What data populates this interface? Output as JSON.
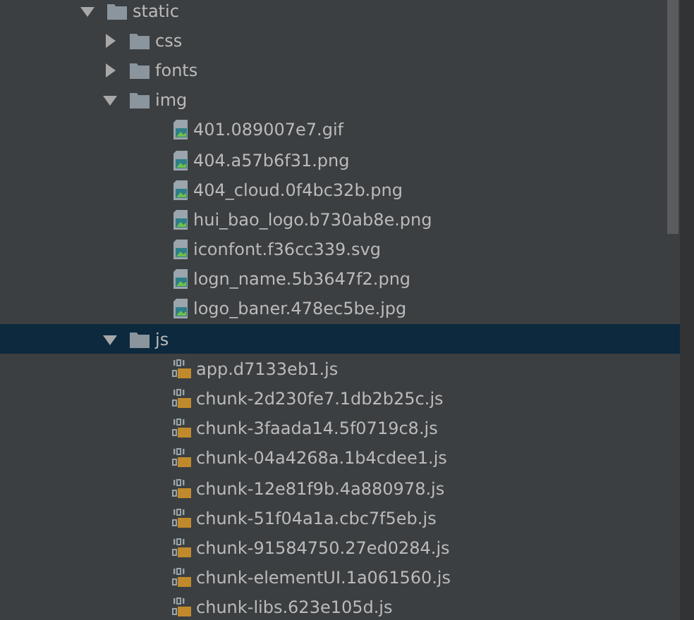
{
  "tree": [
    {
      "label": "static",
      "kind": "folder",
      "expanded": true,
      "selected": false,
      "children": [
        {
          "label": "css",
          "kind": "folder",
          "expanded": false,
          "selected": false
        },
        {
          "label": "fonts",
          "kind": "folder",
          "expanded": false,
          "selected": false
        },
        {
          "label": "img",
          "kind": "folder",
          "expanded": true,
          "selected": false,
          "children": [
            {
              "label": "401.089007e7.gif",
              "kind": "image",
              "selected": false
            },
            {
              "label": "404.a57b6f31.png",
              "kind": "image",
              "selected": false
            },
            {
              "label": "404_cloud.0f4bc32b.png",
              "kind": "image",
              "selected": false
            },
            {
              "label": "hui_bao_logo.b730ab8e.png",
              "kind": "image",
              "selected": false
            },
            {
              "label": "iconfont.f36cc339.svg",
              "kind": "image",
              "selected": false
            },
            {
              "label": "logn_name.5b3647f2.png",
              "kind": "image",
              "selected": false
            },
            {
              "label": "logo_baner.478ec5be.jpg",
              "kind": "image",
              "selected": false
            }
          ]
        },
        {
          "label": "js",
          "kind": "folder",
          "expanded": true,
          "selected": true,
          "children": [
            {
              "label": "app.d7133eb1.js",
              "kind": "script",
              "selected": false
            },
            {
              "label": "chunk-2d230fe7.1db2b25c.js",
              "kind": "script",
              "selected": false
            },
            {
              "label": "chunk-3faada14.5f0719c8.js",
              "kind": "script",
              "selected": false
            },
            {
              "label": "chunk-04a4268a.1b4cdee1.js",
              "kind": "script",
              "selected": false
            },
            {
              "label": "chunk-12e81f9b.4a880978.js",
              "kind": "script",
              "selected": false
            },
            {
              "label": "chunk-51f04a1a.cbc7f5eb.js",
              "kind": "script",
              "selected": false
            },
            {
              "label": "chunk-91584750.27ed0284.js",
              "kind": "script",
              "selected": false
            },
            {
              "label": "chunk-elementUI.1a061560.js",
              "kind": "script",
              "selected": false
            },
            {
              "label": "chunk-libs.623e105d.js",
              "kind": "script",
              "selected": false
            }
          ]
        }
      ]
    }
  ]
}
